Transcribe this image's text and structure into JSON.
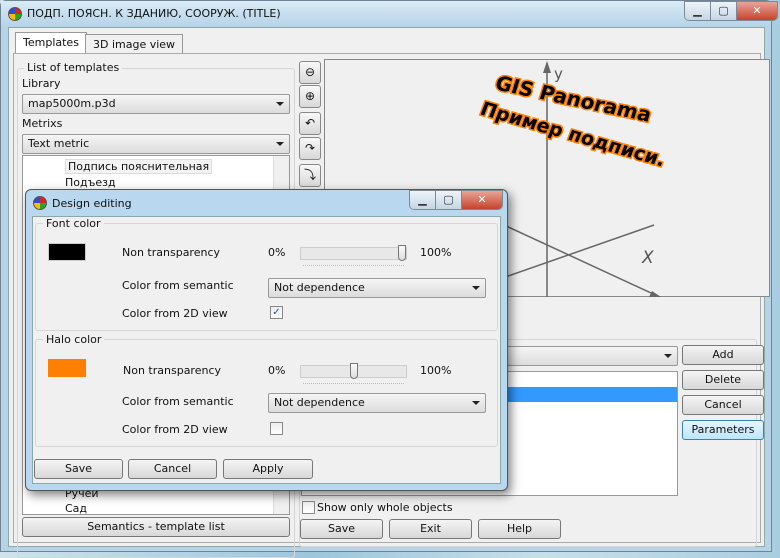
{
  "window": {
    "title": "ПОДП. ПОЯСН. К ЗДАНИЮ, СООРУЖ. (TITLE)",
    "minimize": "▁",
    "maximize": "▢",
    "close": "✕"
  },
  "tabs": [
    {
      "label": "Templates",
      "active": true
    },
    {
      "label": "3D image view",
      "active": false
    }
  ],
  "templates": {
    "group_label": "List of templates",
    "library_label": "Library",
    "library_value": "map5000m.p3d",
    "metrixs_label": "Metrixs",
    "metrixs_value": "Text metric",
    "tree_items": [
      "Подпись пояснительная",
      "Подъезд",
      "Ручей",
      "Сад"
    ],
    "selected_item": "Подпись пояснительная",
    "semantics_button": "Semantics - template list"
  },
  "toolbar": {
    "icons": [
      "zoom-out-icon",
      "zoom-in-icon",
      "rotate-z-left-icon",
      "rotate-z-right-icon",
      "rotate-y-icon"
    ]
  },
  "preview": {
    "axis_x": "X",
    "axis_y": "y",
    "line1": "GIS Panorama",
    "line2": "Пример подписи.",
    "font_color": "#000000",
    "halo_color": "#ff8000"
  },
  "objects": {
    "add": "Add",
    "delete": "Delete",
    "cancel": "Cancel",
    "parameters": "Parameters",
    "show_whole_label": "Show only whole objects",
    "show_whole_checked": false
  },
  "footer": {
    "save": "Save",
    "exit": "Exit",
    "help": "Help"
  },
  "dialog": {
    "title": "Design editing",
    "font": {
      "group": "Font color",
      "color": "#000000",
      "non_transparency_label": "Non transparency",
      "min": "0%",
      "max": "100%",
      "value_percent": 100,
      "semantic_label": "Color from semantic",
      "semantic_value": "Not dependence",
      "view2d_label": "Color from 2D view",
      "view2d_checked": true
    },
    "halo": {
      "group": "Halo color",
      "color": "#ff8000",
      "non_transparency_label": "Non transparency",
      "min": "0%",
      "max": "100%",
      "value_percent": 50,
      "semantic_label": "Color from semantic",
      "semantic_value": "Not dependence",
      "view2d_label": "Color from 2D view",
      "view2d_checked": false
    },
    "save": "Save",
    "cancel": "Cancel",
    "apply": "Apply"
  }
}
